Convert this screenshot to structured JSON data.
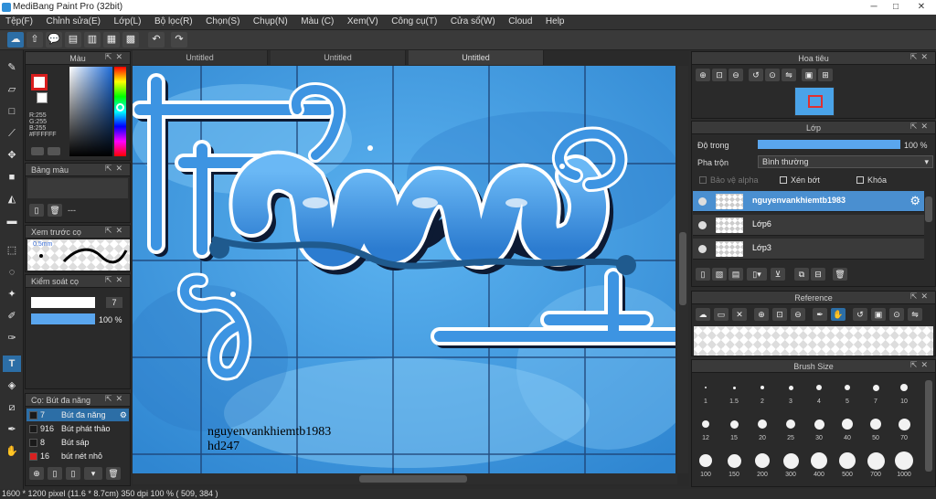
{
  "window": {
    "title": "MediBang Paint Pro (32bit)",
    "minimize": "─",
    "maximize": "□",
    "close": "✕"
  },
  "menu": [
    "Tệp(F)",
    "Chỉnh sửa(E)",
    "Lớp(L)",
    "Bộ lọc(R)",
    "Chọn(S)",
    "Chụp(N)",
    "Màu (C)",
    "Xem(V)",
    "Công cụ(T)",
    "Cửa sổ(W)",
    "Cloud",
    "Help"
  ],
  "tabs": [
    "Untitled",
    "Untitled",
    "Untitled"
  ],
  "color_panel": {
    "title": "Màu",
    "rgb_r": "R:255",
    "rgb_g": "G:255",
    "rgb_b": "B:255",
    "hex": "#FFFFFF",
    "primary": "#ffffff",
    "secondary": "#d91e1e"
  },
  "swatch_panel": {
    "title": "Bảng màu",
    "value": "---"
  },
  "preview_panel": {
    "title": "Xem trước cọ",
    "size": "0.5mm"
  },
  "control_panel": {
    "title": "Kiểm soát cọ",
    "size_value": "7",
    "opacity_value": "100 %",
    "opacity": 1.0
  },
  "brush_panel": {
    "title": "Cọ: Bút đa năng",
    "items": [
      {
        "size": "7",
        "name": "Bút đa năng",
        "color": "#1a1a1a",
        "selected": true
      },
      {
        "size": "916",
        "name": "Bút phát thảo",
        "color": "#1a1a1a",
        "selected": false
      },
      {
        "size": "8",
        "name": "Bút sáp",
        "color": "#1a1a1a",
        "selected": false
      },
      {
        "size": "16",
        "name": "bút nét nhỏ",
        "color": "#d92020",
        "selected": false
      }
    ]
  },
  "navigator": {
    "title": "Hoa tiêu"
  },
  "layer_panel": {
    "title": "Lớp",
    "opacity_label": "Độ trong",
    "opacity_value": "100 %",
    "opacity": 1.0,
    "blend_label": "Pha trộn",
    "blend_value": "Bình thường",
    "protect_alpha": "Bảo vệ alpha",
    "clipping": "Xén bớt",
    "lock": "Khóa",
    "layers": [
      {
        "name": "nguyenvankhiemtb1983",
        "selected": true
      },
      {
        "name": "Lớp6",
        "selected": false
      },
      {
        "name": "Lớp3",
        "selected": false
      }
    ]
  },
  "reference_panel": {
    "title": "Reference"
  },
  "brush_size_panel": {
    "title": "Brush Size",
    "sizes": [
      "1",
      "1.5",
      "2",
      "3",
      "4",
      "5",
      "7",
      "10",
      "12",
      "15",
      "20",
      "25",
      "30",
      "40",
      "50",
      "70",
      "100",
      "150",
      "200",
      "300",
      "400",
      "500",
      "700",
      "1000"
    ]
  },
  "canvas": {
    "watermark_line1": "nguyenvankhiemtb1983",
    "watermark_line2": "hd247"
  },
  "status": {
    "text": "1600 * 1200 pixel   (11.6 * 8.7cm)   350 dpi   100 %   ( 509, 384 )"
  },
  "colors": {
    "accent": "#2c6ea6",
    "art_bg": "#4aa3e8",
    "letter": "#3b8fe0"
  }
}
